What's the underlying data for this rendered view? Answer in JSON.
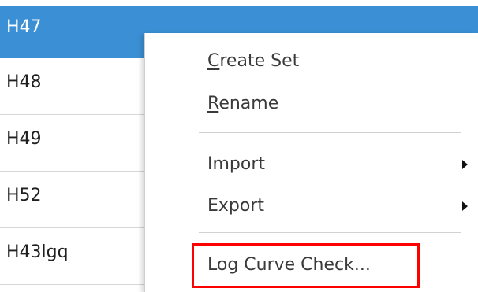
{
  "list": {
    "items": [
      {
        "label": "H47",
        "selected": true
      },
      {
        "label": "H48",
        "selected": false
      },
      {
        "label": "H49",
        "selected": false
      },
      {
        "label": "H52",
        "selected": false
      },
      {
        "label": "H43lgq",
        "selected": false
      }
    ]
  },
  "context_menu": {
    "create_set": {
      "mnemonic": "C",
      "rest": "reate Set"
    },
    "rename": {
      "mnemonic": "R",
      "rest": "ename"
    },
    "import": "Import",
    "export": "Export",
    "log_curve_check": "Log Curve Check..."
  },
  "colors": {
    "selection": "#3b8fd4",
    "highlight_box": "#ff0000"
  }
}
